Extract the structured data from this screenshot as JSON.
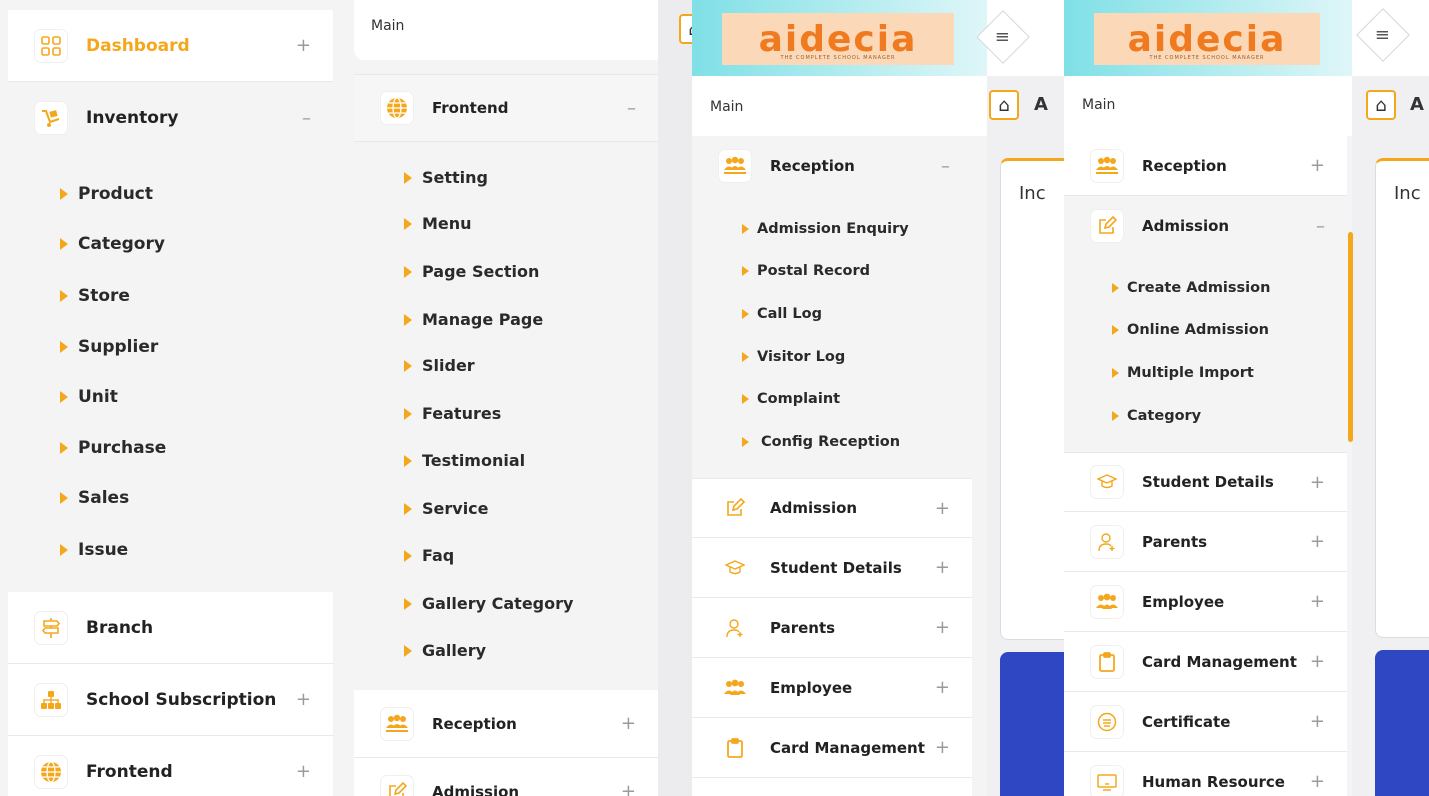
{
  "panel1": {
    "dashboard": {
      "label": "Dashboard",
      "toggle": "+"
    },
    "inventory": {
      "label": "Inventory",
      "toggle": "–"
    },
    "inventory_items": [
      "Product",
      "Category",
      "Store",
      "Supplier",
      "Unit",
      "Purchase",
      "Sales",
      "Issue"
    ],
    "branch": {
      "label": "Branch"
    },
    "school_subscription": {
      "label": "School Subscription",
      "toggle": "+"
    },
    "frontend": {
      "label": "Frontend",
      "toggle": "+"
    }
  },
  "panel2": {
    "main_label": "Main",
    "frontend": {
      "label": "Frontend",
      "toggle": "–"
    },
    "frontend_items": [
      "Setting",
      "Menu",
      "Page Section",
      "Manage Page",
      "Slider",
      "Features",
      "Testimonial",
      "Service",
      "Faq",
      "Gallery Category",
      "Gallery"
    ],
    "reception": {
      "label": "Reception",
      "toggle": "+"
    },
    "admission": {
      "label": "Admission",
      "toggle": "+"
    }
  },
  "panel3": {
    "logo_text": "aidecia",
    "logo_subtitle": "THE COMPLETE SCHOOL MANAGER",
    "menu_glyph": "≡",
    "main_label": "Main",
    "breadcrumb_letter": "A",
    "card_title": "Inc",
    "reception": {
      "label": "Reception",
      "toggle": "–"
    },
    "reception_items": [
      "Admission Enquiry",
      "Postal Record",
      "Call Log",
      "Visitor Log",
      "Complaint",
      "Config Reception"
    ],
    "admission": {
      "label": "Admission",
      "toggle": "+"
    },
    "student_details": {
      "label": "Student Details",
      "toggle": "+"
    },
    "parents": {
      "label": "Parents",
      "toggle": "+"
    },
    "employee": {
      "label": "Employee",
      "toggle": "+"
    },
    "card_management": {
      "label": "Card Management",
      "toggle": "+"
    }
  },
  "panel4": {
    "logo_text": "aidecia",
    "logo_subtitle": "THE COMPLETE SCHOOL MANAGER",
    "menu_glyph": "≡",
    "main_label": "Main",
    "breadcrumb_letter": "A",
    "card_title": "Inc",
    "reception": {
      "label": "Reception",
      "toggle": "+"
    },
    "admission": {
      "label": "Admission",
      "toggle": "–"
    },
    "admission_items": [
      "Create Admission",
      "Online Admission",
      "Multiple Import",
      "Category"
    ],
    "student_details": {
      "label": "Student Details",
      "toggle": "+"
    },
    "parents": {
      "label": "Parents",
      "toggle": "+"
    },
    "employee": {
      "label": "Employee",
      "toggle": "+"
    },
    "card_management": {
      "label": "Card Management",
      "toggle": "+"
    },
    "certificate": {
      "label": "Certificate",
      "toggle": "+"
    },
    "human_resource": {
      "label": "Human Resource",
      "toggle": "+"
    }
  },
  "colors": {
    "accent": "#f5a71c",
    "logo": "#f07a1f",
    "content_blue": "#3047c4"
  }
}
